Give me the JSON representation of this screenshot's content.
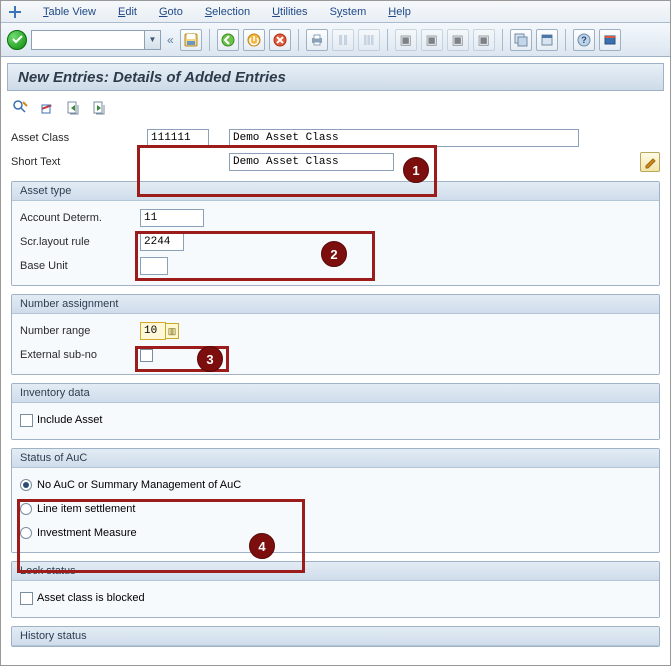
{
  "menu": {
    "items": [
      "Table View",
      "Edit",
      "Goto",
      "Selection",
      "Utilities",
      "System",
      "Help"
    ]
  },
  "title": "New Entries: Details of Added Entries",
  "header": {
    "asset_class_label": "Asset Class",
    "asset_class_value": "111111",
    "asset_class_desc": "Demo Asset Class",
    "short_text_label": "Short Text",
    "short_text_value": "Demo Asset Class"
  },
  "groups": {
    "asset_type": {
      "title": "Asset type",
      "account_determ_label": "Account Determ.",
      "account_determ_value": "11",
      "scr_layout_label": "Scr.layout rule",
      "scr_layout_value": "2244",
      "base_unit_label": "Base Unit",
      "base_unit_value": ""
    },
    "number_assignment": {
      "title": "Number assignment",
      "number_range_label": "Number range",
      "number_range_value": "10",
      "external_subno_label": "External sub-no"
    },
    "inventory": {
      "title": "Inventory data",
      "include_asset_label": "Include Asset"
    },
    "status_auc": {
      "title": "Status of AuC",
      "opt1": "No AuC or Summary Management of AuC",
      "opt2": "Line item settlement",
      "opt3": "Investment Measure"
    },
    "lock_status": {
      "title": "Lock status",
      "blocked_label": "Asset class is blocked"
    },
    "history_status": {
      "title": "History status"
    }
  },
  "callouts": {
    "c1": "1",
    "c2": "2",
    "c3": "3",
    "c4": "4"
  }
}
